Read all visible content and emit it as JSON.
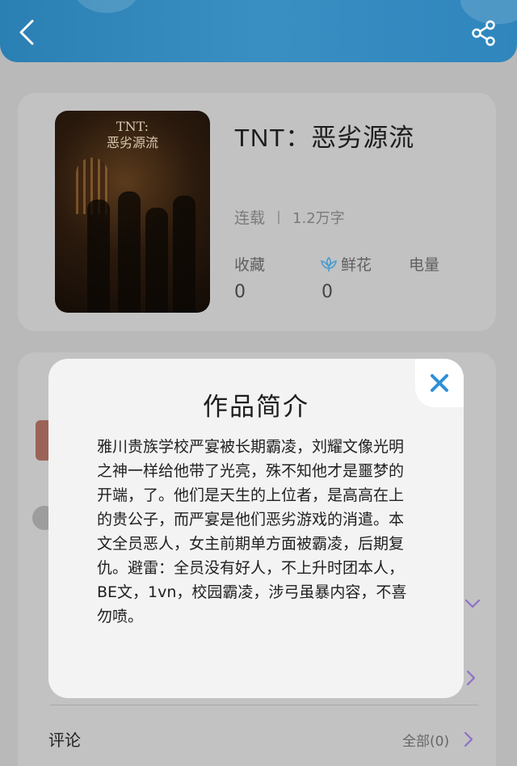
{
  "colors": {
    "header": "#2f86bd",
    "accent_purple": "#8e6fc9",
    "close_blue": "#2d8fd6",
    "flower_blue": "#4a9bd1"
  },
  "header": {
    "back_icon": "chevron-left-icon",
    "share_icon": "share-icon"
  },
  "book": {
    "cover_text": "TNT:\n恶劣源流",
    "title": "TNT：恶劣源流",
    "status": "连载",
    "word_count": "1.2万字",
    "stats": [
      {
        "label": "收藏",
        "value": "0"
      },
      {
        "label": "鲜花",
        "value": "0",
        "icon": "flower-icon"
      },
      {
        "label": "电量",
        "value": ""
      }
    ]
  },
  "comments": {
    "label": "评论",
    "all_link": "全部(0)"
  },
  "modal": {
    "title": "作品简介",
    "body": "雅川贵族学校严宴被长期霸凌，刘耀文像光明之神一样给他带了光亮，殊不知他才是噩梦的开端，了。他们是天生的上位者，是高高在上的贵公子，而严宴是他们恶劣游戏的消遣。本文全员恶人，女主前期单方面被霸凌，后期复仇。避雷：全员没有好人，不上升时团本人，BE文，1vn，校园霸凌，涉弓虽暴内容，不喜勿喷。",
    "close_icon": "close-icon"
  }
}
